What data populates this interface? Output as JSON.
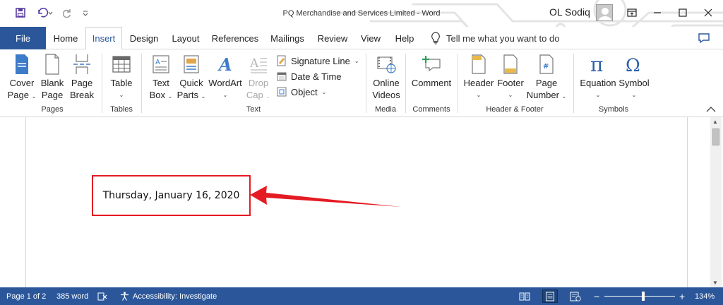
{
  "window": {
    "title": "PQ Merchandise and Services Limited  -  Word",
    "user_name": "OL Sodiq"
  },
  "quick_access": {
    "icons": [
      "save-icon",
      "undo-icon",
      "redo-icon",
      "customize-qat-icon"
    ]
  },
  "tabs": [
    {
      "label": "File"
    },
    {
      "label": "Home"
    },
    {
      "label": "Insert"
    },
    {
      "label": "Design"
    },
    {
      "label": "Layout"
    },
    {
      "label": "References"
    },
    {
      "label": "Mailings"
    },
    {
      "label": "Review"
    },
    {
      "label": "View"
    },
    {
      "label": "Help"
    }
  ],
  "active_tab": "Insert",
  "tell_me": "Tell me what you want to do",
  "ribbon": {
    "pages": {
      "label": "Pages",
      "cover": {
        "l1": "Cover",
        "l2": "Page"
      },
      "blank": {
        "l1": "Blank",
        "l2": "Page"
      },
      "break": {
        "l1": "Page",
        "l2": "Break"
      }
    },
    "tables": {
      "label": "Tables",
      "table": "Table"
    },
    "text": {
      "label": "Text",
      "textbox": {
        "l1": "Text",
        "l2": "Box"
      },
      "quickparts": {
        "l1": "Quick",
        "l2": "Parts"
      },
      "wordart": "WordArt",
      "dropcap": {
        "l1": "Drop",
        "l2": "Cap"
      },
      "signature": "Signature Line",
      "datetime": "Date & Time",
      "object": "Object"
    },
    "media": {
      "label": "Media",
      "online": {
        "l1": "Online",
        "l2": "Videos"
      }
    },
    "comments": {
      "label": "Comments",
      "comment": "Comment"
    },
    "header_footer": {
      "label": "Header & Footer",
      "header": "Header",
      "footer": "Footer",
      "pagenum": {
        "l1": "Page",
        "l2": "Number"
      }
    },
    "symbols": {
      "label": "Symbols",
      "equation": "Equation",
      "symbol": "Symbol"
    }
  },
  "document": {
    "date_text": "Thursday, January 16, 2020"
  },
  "status": {
    "page": "Page 1 of 2",
    "words": "385 word",
    "accessibility": "Accessibility: Investigate",
    "zoom_minus": "−",
    "zoom_plus": "+",
    "zoom": "134%"
  },
  "colors": {
    "accent": "#2b579a",
    "annotation": "#e51b23"
  }
}
